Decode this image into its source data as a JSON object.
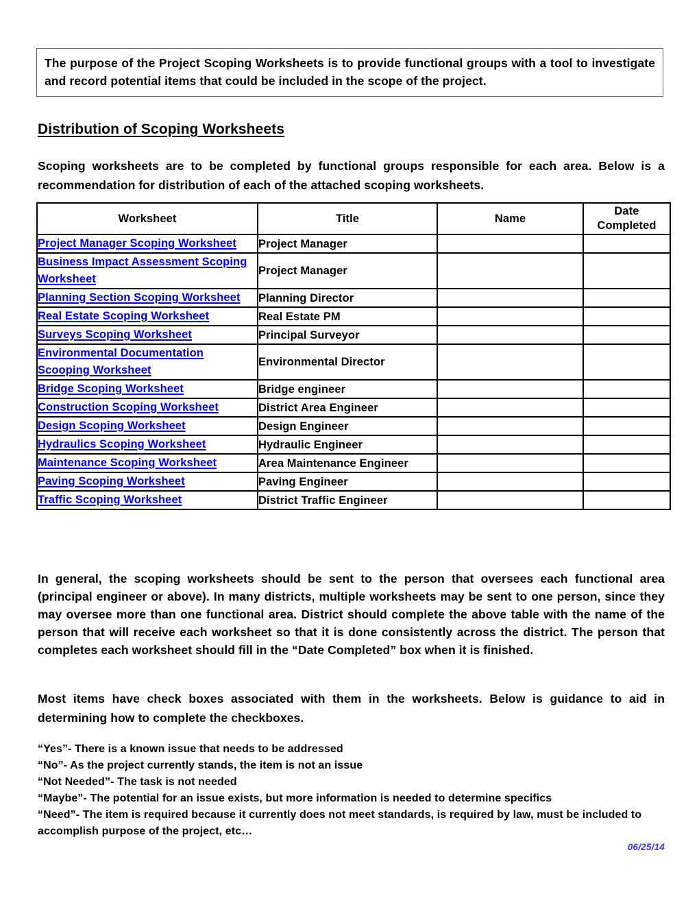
{
  "document": {
    "purpose_box": {
      "text": "The purpose of the Project Scoping Worksheets is to provide functional groups with a tool to investigate and record potential items that could be included in the scope of the project."
    },
    "section_heading": "Distribution of Scoping Worksheets\t\t\t\t\t",
    "intro_paragraph": "Scoping worksheets are to be completed by functional groups responsible for each area. Below is a recommendation for distribution of each of the attached scoping worksheets.",
    "table": {
      "headers": [
        "Worksheet",
        "Title",
        "Name",
        "Date Completed"
      ],
      "rows": [
        {
          "worksheet": "Project Manager Scoping Worksheet",
          "title": "Project Manager",
          "name": "",
          "date_completed": ""
        },
        {
          "worksheet": "Business Impact Assessment Scoping Worksheet",
          "title": "Project Manager",
          "name": "",
          "date_completed": ""
        },
        {
          "worksheet": "Planning Section Scoping Worksheet",
          "title": "Planning Director",
          "name": "",
          "date_completed": ""
        },
        {
          "worksheet": "Real Estate Scoping Worksheet",
          "title": "Real Estate PM",
          "name": "",
          "date_completed": ""
        },
        {
          "worksheet": "Surveys Scoping Worksheet",
          "title": "Principal Surveyor",
          "name": "",
          "date_completed": ""
        },
        {
          "worksheet": "Environmental Documentation Scooping Worksheet",
          "title": "Environmental Director",
          "name": "",
          "date_completed": ""
        },
        {
          "worksheet": "Bridge Scoping Worksheet",
          "title": "Bridge engineer",
          "name": "",
          "date_completed": ""
        },
        {
          "worksheet": "Construction Scoping Worksheet",
          "title": "District Area Engineer",
          "name": "",
          "date_completed": ""
        },
        {
          "worksheet": "Design Scoping Worksheet",
          "title": "Design Engineer",
          "name": "",
          "date_completed": ""
        },
        {
          "worksheet": "Hydraulics Scoping Worksheet",
          "title": "Hydraulic Engineer",
          "name": "",
          "date_completed": ""
        },
        {
          "worksheet": "Maintenance Scoping Worksheet",
          "title": "Area Maintenance Engineer",
          "name": "",
          "date_completed": ""
        },
        {
          "worksheet": "Paving Scoping Worksheet",
          "title": "Paving Engineer",
          "name": "",
          "date_completed": ""
        },
        {
          "worksheet": "Traffic Scoping Worksheet",
          "title": "District Traffic Engineer",
          "name": "",
          "date_completed": ""
        }
      ]
    },
    "general_paragraph": "In general, the scoping worksheets should be sent to the person that oversees each functional area (principal engineer or above). In many districts, multiple worksheets may be sent to one person, since they may oversee more than one functional area. District should complete the above table with the name of the person that will receive each worksheet so that it is done consistently across the district. The person that completes each worksheet should fill in the “Date Completed” box when it is finished.",
    "checkbox_paragraph": "Most items have check boxes associated with them in the worksheets. Below is guidance to aid in determining how to complete the checkboxes.",
    "definitions": [
      "“Yes”- There is a known issue that needs to be addressed",
      "“No”- As the project currently stands, the item is not an issue",
      "“Not Needed”- The task is not needed",
      "“Maybe”- The potential for an issue exists, but more information is needed to determine specifics",
      "“Need”- The item is required because it currently does not meet standards, is required by law, must be included to accomplish purpose of the project, etc…"
    ],
    "footer_date": "06/25/14",
    "colors": {
      "link": "#0000FF",
      "footer_date": "#3333FF",
      "table_border": "#000000",
      "box_border": "#5A5A5A"
    }
  }
}
